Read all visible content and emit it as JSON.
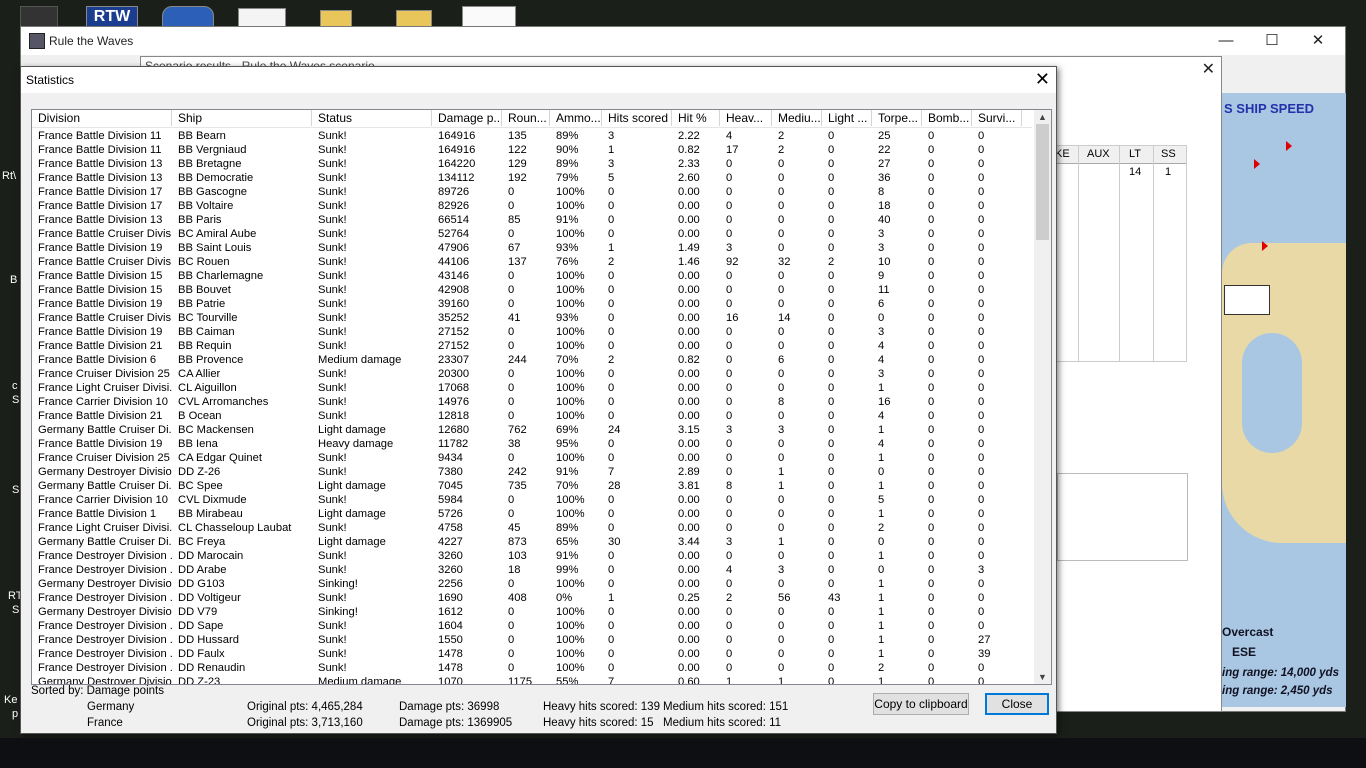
{
  "desktop": {
    "icon_labels": [
      "RTW"
    ],
    "side_labels": [
      "Rt\\",
      "B",
      "c",
      "S",
      "S",
      "RT",
      "S",
      "Ke",
      "p"
    ]
  },
  "app": {
    "title": "Rule the Waves",
    "min_glyph": "—",
    "max_glyph": "☐",
    "close_glyph": "✕"
  },
  "report_window": {
    "title": "Scenario results - Rule the Waves scenario",
    "close_glyph": "✕",
    "grid_headers": [
      "KE",
      "AUX",
      "LT",
      "SS"
    ],
    "grid_values": [
      "",
      "",
      "14",
      "1"
    ],
    "map_title": "S SHIP SPEED",
    "weather": "Overcast",
    "wind": "ESE",
    "range1": "ing range: 14,000 yds",
    "range2": "ing range: 2,450 yds"
  },
  "dialog": {
    "title": "Statistics",
    "close_glyph": "✕",
    "columns": [
      "Division",
      "Ship",
      "Status",
      "Damage p...",
      "Roun...",
      "Ammo...",
      "Hits scored",
      "Hit %",
      "Heav...",
      "Mediu...",
      "Light ...",
      "Torpe...",
      "Bomb...",
      "Survi..."
    ],
    "rows": [
      [
        "France Battle Division 11",
        "BB Bearn",
        "Sunk!",
        "164916",
        "135",
        "89%",
        "3",
        "2.22",
        "4",
        "2",
        "0",
        "25",
        "0",
        "0"
      ],
      [
        "France Battle Division 11",
        "BB Vergniaud",
        "Sunk!",
        "164916",
        "122",
        "90%",
        "1",
        "0.82",
        "17",
        "2",
        "0",
        "22",
        "0",
        "0"
      ],
      [
        "France Battle Division 13",
        "BB Bretagne",
        "Sunk!",
        "164220",
        "129",
        "89%",
        "3",
        "2.33",
        "0",
        "0",
        "0",
        "27",
        "0",
        "0"
      ],
      [
        "France Battle Division 13",
        "BB Democratie",
        "Sunk!",
        "134112",
        "192",
        "79%",
        "5",
        "2.60",
        "0",
        "0",
        "0",
        "36",
        "0",
        "0"
      ],
      [
        "France Battle Division 17",
        "BB Gascogne",
        "Sunk!",
        "89726",
        "0",
        "100%",
        "0",
        "0.00",
        "0",
        "0",
        "0",
        "8",
        "0",
        "0"
      ],
      [
        "France Battle Division 17",
        "BB Voltaire",
        "Sunk!",
        "82926",
        "0",
        "100%",
        "0",
        "0.00",
        "0",
        "0",
        "0",
        "18",
        "0",
        "0"
      ],
      [
        "France Battle Division 13",
        "BB Paris",
        "Sunk!",
        "66514",
        "85",
        "91%",
        "0",
        "0.00",
        "0",
        "0",
        "0",
        "40",
        "0",
        "0"
      ],
      [
        "France Battle Cruiser Divis...",
        "BC Amiral Aube",
        "Sunk!",
        "52764",
        "0",
        "100%",
        "0",
        "0.00",
        "0",
        "0",
        "0",
        "3",
        "0",
        "0"
      ],
      [
        "France Battle Division 19",
        "BB Saint Louis",
        "Sunk!",
        "47906",
        "67",
        "93%",
        "1",
        "1.49",
        "3",
        "0",
        "0",
        "3",
        "0",
        "0"
      ],
      [
        "France Battle Cruiser Divis...",
        "BC Rouen",
        "Sunk!",
        "44106",
        "137",
        "76%",
        "2",
        "1.46",
        "92",
        "32",
        "2",
        "10",
        "0",
        "0"
      ],
      [
        "France Battle Division 15",
        "BB Charlemagne",
        "Sunk!",
        "43146",
        "0",
        "100%",
        "0",
        "0.00",
        "0",
        "0",
        "0",
        "9",
        "0",
        "0"
      ],
      [
        "France Battle Division 15",
        "BB Bouvet",
        "Sunk!",
        "42908",
        "0",
        "100%",
        "0",
        "0.00",
        "0",
        "0",
        "0",
        "11",
        "0",
        "0"
      ],
      [
        "France Battle Division 19",
        "BB Patrie",
        "Sunk!",
        "39160",
        "0",
        "100%",
        "0",
        "0.00",
        "0",
        "0",
        "0",
        "6",
        "0",
        "0"
      ],
      [
        "France Battle Cruiser Divis...",
        "BC Tourville",
        "Sunk!",
        "35252",
        "41",
        "93%",
        "0",
        "0.00",
        "16",
        "14",
        "0",
        "0",
        "0",
        "0"
      ],
      [
        "France Battle Division 19",
        "BB Caiman",
        "Sunk!",
        "27152",
        "0",
        "100%",
        "0",
        "0.00",
        "0",
        "0",
        "0",
        "3",
        "0",
        "0"
      ],
      [
        "France Battle Division 21",
        "BB Requin",
        "Sunk!",
        "27152",
        "0",
        "100%",
        "0",
        "0.00",
        "0",
        "0",
        "0",
        "4",
        "0",
        "0"
      ],
      [
        "France Battle Division 6",
        "BB Provence",
        "Medium damage",
        "23307",
        "244",
        "70%",
        "2",
        "0.82",
        "0",
        "6",
        "0",
        "4",
        "0",
        "0"
      ],
      [
        "France Cruiser Division 25",
        "CA Allier",
        "Sunk!",
        "20300",
        "0",
        "100%",
        "0",
        "0.00",
        "0",
        "0",
        "0",
        "3",
        "0",
        "0"
      ],
      [
        "France Light Cruiser Divisi...",
        "CL Aiguillon",
        "Sunk!",
        "17068",
        "0",
        "100%",
        "0",
        "0.00",
        "0",
        "0",
        "0",
        "1",
        "0",
        "0"
      ],
      [
        "France Carrier Division 10",
        "CVL Arromanches",
        "Sunk!",
        "14976",
        "0",
        "100%",
        "0",
        "0.00",
        "0",
        "8",
        "0",
        "16",
        "0",
        "0"
      ],
      [
        "France Battle Division 21",
        "B Ocean",
        "Sunk!",
        "12818",
        "0",
        "100%",
        "0",
        "0.00",
        "0",
        "0",
        "0",
        "4",
        "0",
        "0"
      ],
      [
        "Germany Battle Cruiser Di...",
        "BC Mackensen",
        "Light damage",
        "12680",
        "762",
        "69%",
        "24",
        "3.15",
        "3",
        "3",
        "0",
        "1",
        "0",
        "0"
      ],
      [
        "France Battle Division 19",
        "BB Iena",
        "Heavy damage",
        "11782",
        "38",
        "95%",
        "0",
        "0.00",
        "0",
        "0",
        "0",
        "4",
        "0",
        "0"
      ],
      [
        "France Cruiser Division 25",
        "CA Edgar Quinet",
        "Sunk!",
        "9434",
        "0",
        "100%",
        "0",
        "0.00",
        "0",
        "0",
        "0",
        "1",
        "0",
        "0"
      ],
      [
        "Germany Destroyer Divisio...",
        "DD Z-26",
        "Sunk!",
        "7380",
        "242",
        "91%",
        "7",
        "2.89",
        "0",
        "1",
        "0",
        "0",
        "0",
        "0"
      ],
      [
        "Germany Battle Cruiser Di...",
        "BC Spee",
        "Light damage",
        "7045",
        "735",
        "70%",
        "28",
        "3.81",
        "8",
        "1",
        "0",
        "1",
        "0",
        "0"
      ],
      [
        "France Carrier Division 10",
        "CVL Dixmude",
        "Sunk!",
        "5984",
        "0",
        "100%",
        "0",
        "0.00",
        "0",
        "0",
        "0",
        "5",
        "0",
        "0"
      ],
      [
        "France Battle Division 1",
        "BB Mirabeau",
        "Light damage",
        "5726",
        "0",
        "100%",
        "0",
        "0.00",
        "0",
        "0",
        "0",
        "1",
        "0",
        "0"
      ],
      [
        "France Light Cruiser Divisi...",
        "CL Chasseloup Laubat",
        "Sunk!",
        "4758",
        "45",
        "89%",
        "0",
        "0.00",
        "0",
        "0",
        "0",
        "2",
        "0",
        "0"
      ],
      [
        "Germany Battle Cruiser Di...",
        "BC Freya",
        "Light damage",
        "4227",
        "873",
        "65%",
        "30",
        "3.44",
        "3",
        "1",
        "0",
        "0",
        "0",
        "0"
      ],
      [
        "France Destroyer Division ...",
        "DD Marocain",
        "Sunk!",
        "3260",
        "103",
        "91%",
        "0",
        "0.00",
        "0",
        "0",
        "0",
        "1",
        "0",
        "0"
      ],
      [
        "France Destroyer Division ...",
        "DD Arabe",
        "Sunk!",
        "3260",
        "18",
        "99%",
        "0",
        "0.00",
        "4",
        "3",
        "0",
        "0",
        "0",
        "3"
      ],
      [
        "Germany Destroyer Divisio...",
        "DD G103",
        "Sinking!",
        "2256",
        "0",
        "100%",
        "0",
        "0.00",
        "0",
        "0",
        "0",
        "1",
        "0",
        "0"
      ],
      [
        "France Destroyer Division ...",
        "DD Voltigeur",
        "Sunk!",
        "1690",
        "408",
        "0%",
        "1",
        "0.25",
        "2",
        "56",
        "43",
        "1",
        "0",
        "0"
      ],
      [
        "Germany Destroyer Divisio...",
        "DD V79",
        "Sinking!",
        "1612",
        "0",
        "100%",
        "0",
        "0.00",
        "0",
        "0",
        "0",
        "1",
        "0",
        "0"
      ],
      [
        "France Destroyer Division ...",
        "DD Sape",
        "Sunk!",
        "1604",
        "0",
        "100%",
        "0",
        "0.00",
        "0",
        "0",
        "0",
        "1",
        "0",
        "0"
      ],
      [
        "France Destroyer Division ...",
        "DD Hussard",
        "Sunk!",
        "1550",
        "0",
        "100%",
        "0",
        "0.00",
        "0",
        "0",
        "0",
        "1",
        "0",
        "27"
      ],
      [
        "France Destroyer Division ...",
        "DD Faulx",
        "Sunk!",
        "1478",
        "0",
        "100%",
        "0",
        "0.00",
        "0",
        "0",
        "0",
        "1",
        "0",
        "39"
      ],
      [
        "France Destroyer Division ...",
        "DD Renaudin",
        "Sunk!",
        "1478",
        "0",
        "100%",
        "0",
        "0.00",
        "0",
        "0",
        "0",
        "2",
        "0",
        "0"
      ],
      [
        "Germany Destroyer Divisio...",
        "DD Z-23",
        "Medium damage",
        "1070",
        "1175",
        "55%",
        "7",
        "0.60",
        "1",
        "1",
        "0",
        "1",
        "0",
        "0"
      ]
    ],
    "sorted_by": "Sorted by: Damage points",
    "summary": [
      {
        "nation": "Germany",
        "original": "Original pts: 4,465,284",
        "damage": "Damage pts: 36998",
        "heavy": "Heavy hits scored: 139",
        "medium": "Medium hits scored: 151"
      },
      {
        "nation": "France",
        "original": "Original pts: 3,713,160",
        "damage": "Damage pts: 1369905",
        "heavy": "Heavy hits scored: 15",
        "medium": "Medium hits scored: 11"
      }
    ],
    "copy_button": "Copy to clipboard",
    "close_button": "Close"
  }
}
